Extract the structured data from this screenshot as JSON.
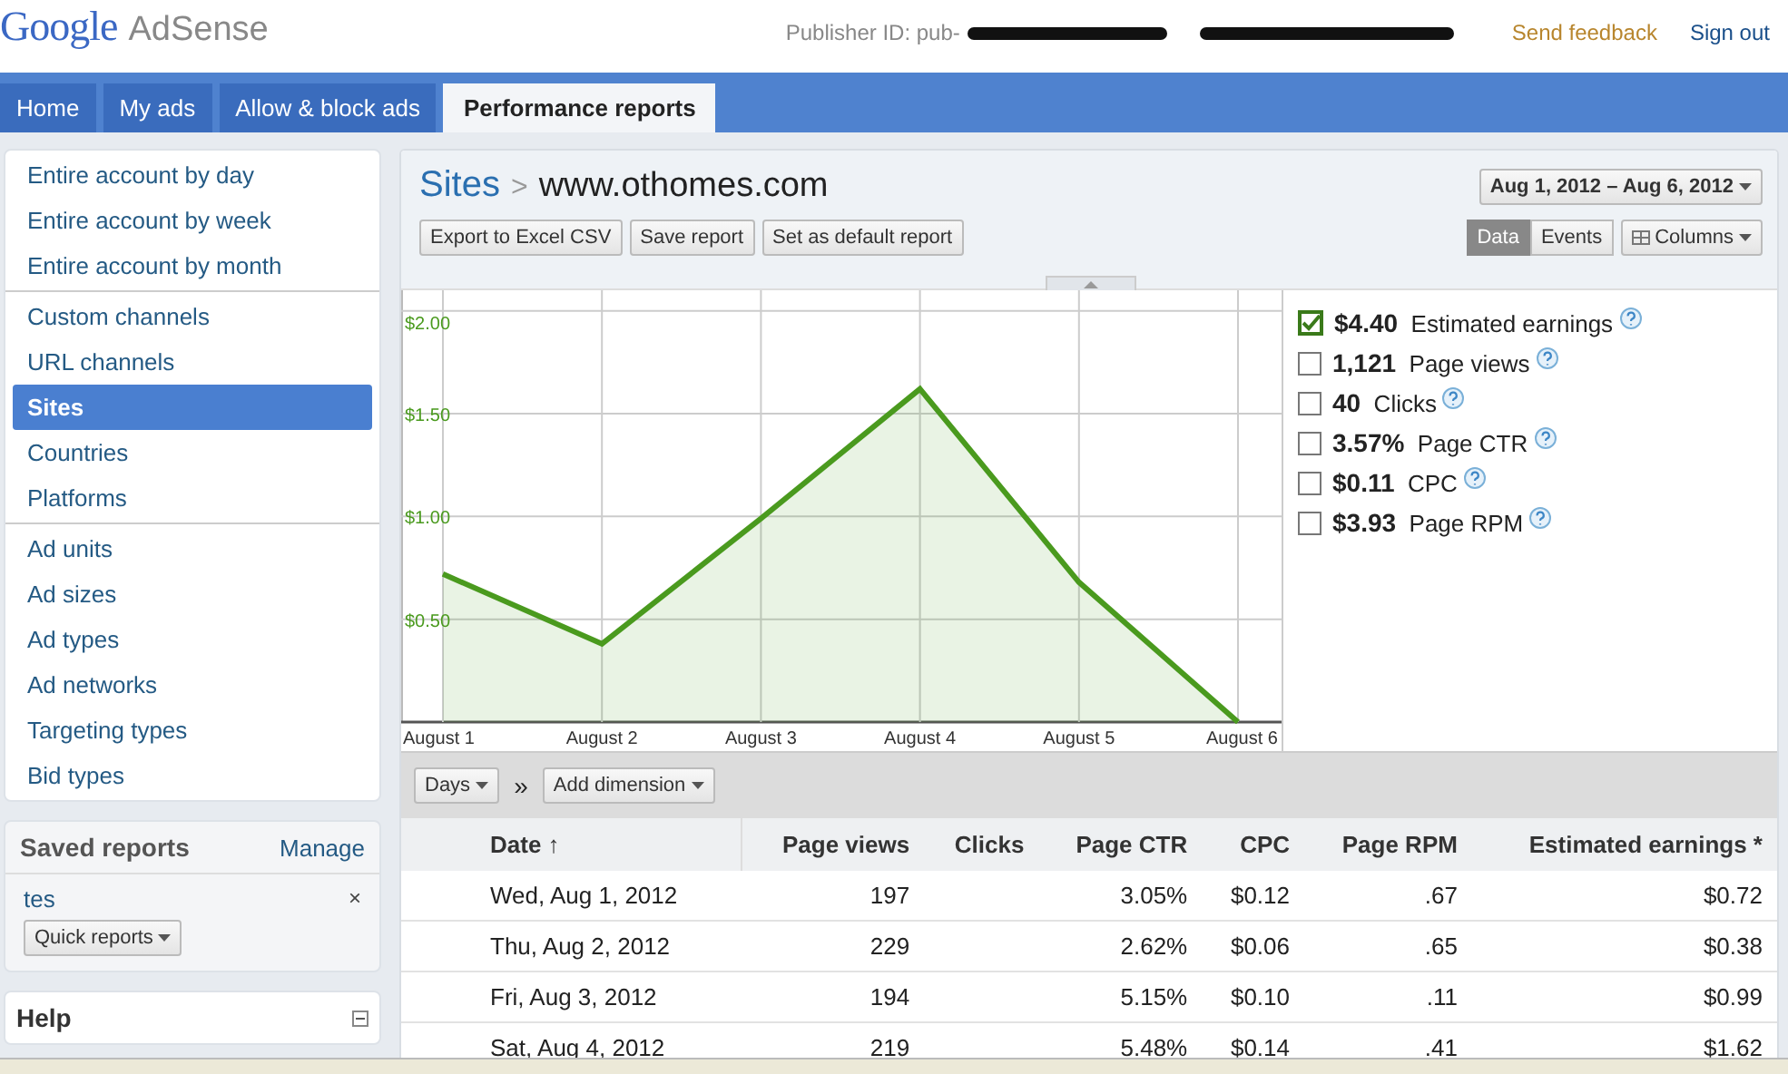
{
  "header": {
    "logo_google": "Google",
    "logo_product": "AdSense",
    "publisher_label": "Publisher ID: pub-",
    "links": [
      "Send feedback",
      "Sign out"
    ]
  },
  "tabs": [
    {
      "label": "Home",
      "selected": false
    },
    {
      "label": "My ads",
      "selected": false
    },
    {
      "label": "Allow & block ads",
      "selected": false
    },
    {
      "label": "Performance reports",
      "selected": true
    }
  ],
  "sidebar": {
    "groups": [
      [
        {
          "label": "Entire account by day",
          "selected": false
        },
        {
          "label": "Entire account by week",
          "selected": false
        },
        {
          "label": "Entire account by month",
          "selected": false
        }
      ],
      [
        {
          "label": "Custom channels",
          "selected": false
        },
        {
          "label": "URL channels",
          "selected": false
        },
        {
          "label": "Sites",
          "selected": true
        },
        {
          "label": "Countries",
          "selected": false
        },
        {
          "label": "Platforms",
          "selected": false
        }
      ],
      [
        {
          "label": "Ad units",
          "selected": false
        },
        {
          "label": "Ad sizes",
          "selected": false
        },
        {
          "label": "Ad types",
          "selected": false
        },
        {
          "label": "Ad networks",
          "selected": false
        },
        {
          "label": "Targeting types",
          "selected": false
        },
        {
          "label": "Bid types",
          "selected": false
        }
      ]
    ],
    "saved_reports": {
      "title": "Saved reports",
      "manage": "Manage",
      "items": [
        {
          "name": "tes",
          "remove": "×"
        }
      ],
      "quick": "Quick reports"
    },
    "help": {
      "title": "Help"
    }
  },
  "report": {
    "crumb": "Sites",
    "separator": ">",
    "site": "www.othomes.com",
    "date_range": "Aug 1, 2012 – Aug 6, 2012",
    "buttons": [
      "Export to Excel CSV",
      "Save report",
      "Set as default report"
    ],
    "views": [
      {
        "label": "Data",
        "selected": true
      },
      {
        "label": "Events",
        "selected": false
      }
    ],
    "columns_button": "Columns",
    "chart_data": {
      "type": "area",
      "categories": [
        "August 1",
        "August 2",
        "August 3",
        "August 4",
        "August 5",
        "August 6"
      ],
      "ylim": [
        0,
        2.1
      ],
      "grid": true,
      "yticks": [
        {
          "value": 0.5,
          "label": "$0.50"
        },
        {
          "value": 1.0,
          "label": "$1.00"
        },
        {
          "value": 1.5,
          "label": "$1.50"
        },
        {
          "value": 2.0,
          "label": "$2.00"
        }
      ],
      "series": [
        {
          "color": "#4a9a1e",
          "values": [
            0.72,
            0.38,
            0.99,
            1.62,
            0.68,
            0.0
          ]
        }
      ]
    },
    "metrics": [
      {
        "total": "$4.40",
        "name": "Estimated earnings",
        "checked": true
      },
      {
        "total": "1,121",
        "name": "Page views",
        "checked": false
      },
      {
        "total": "40",
        "name": "Clicks",
        "checked": false
      },
      {
        "total": "3.57%",
        "name": "Page CTR",
        "checked": false
      },
      {
        "total": "$0.11",
        "name": "CPC",
        "checked": false
      },
      {
        "total": "$3.93",
        "name": "Page RPM",
        "checked": false
      }
    ],
    "dimension_controls": {
      "period": "Days",
      "separator": "»",
      "add": "Add dimension"
    },
    "table": {
      "columns": [
        "Date ↑",
        "Page views",
        "Clicks",
        "Page CTR",
        "CPC",
        "Page RPM",
        "Estimated earnings *"
      ],
      "rows": [
        [
          "Wed, Aug 1, 2012",
          "197",
          "",
          "3.05%",
          "$0.12",
          ".67",
          "$0.72"
        ],
        [
          "Thu, Aug 2, 2012",
          "229",
          "",
          "2.62%",
          "$0.06",
          ".65",
          "$0.38"
        ],
        [
          "Fri, Aug 3, 2012",
          "194",
          "",
          "5.15%",
          "$0.10",
          ".11",
          "$0.99"
        ],
        [
          "Sat, Aug 4, 2012",
          "219",
          "",
          "5.48%",
          "$0.14",
          ".41",
          "$1.62"
        ]
      ]
    }
  }
}
